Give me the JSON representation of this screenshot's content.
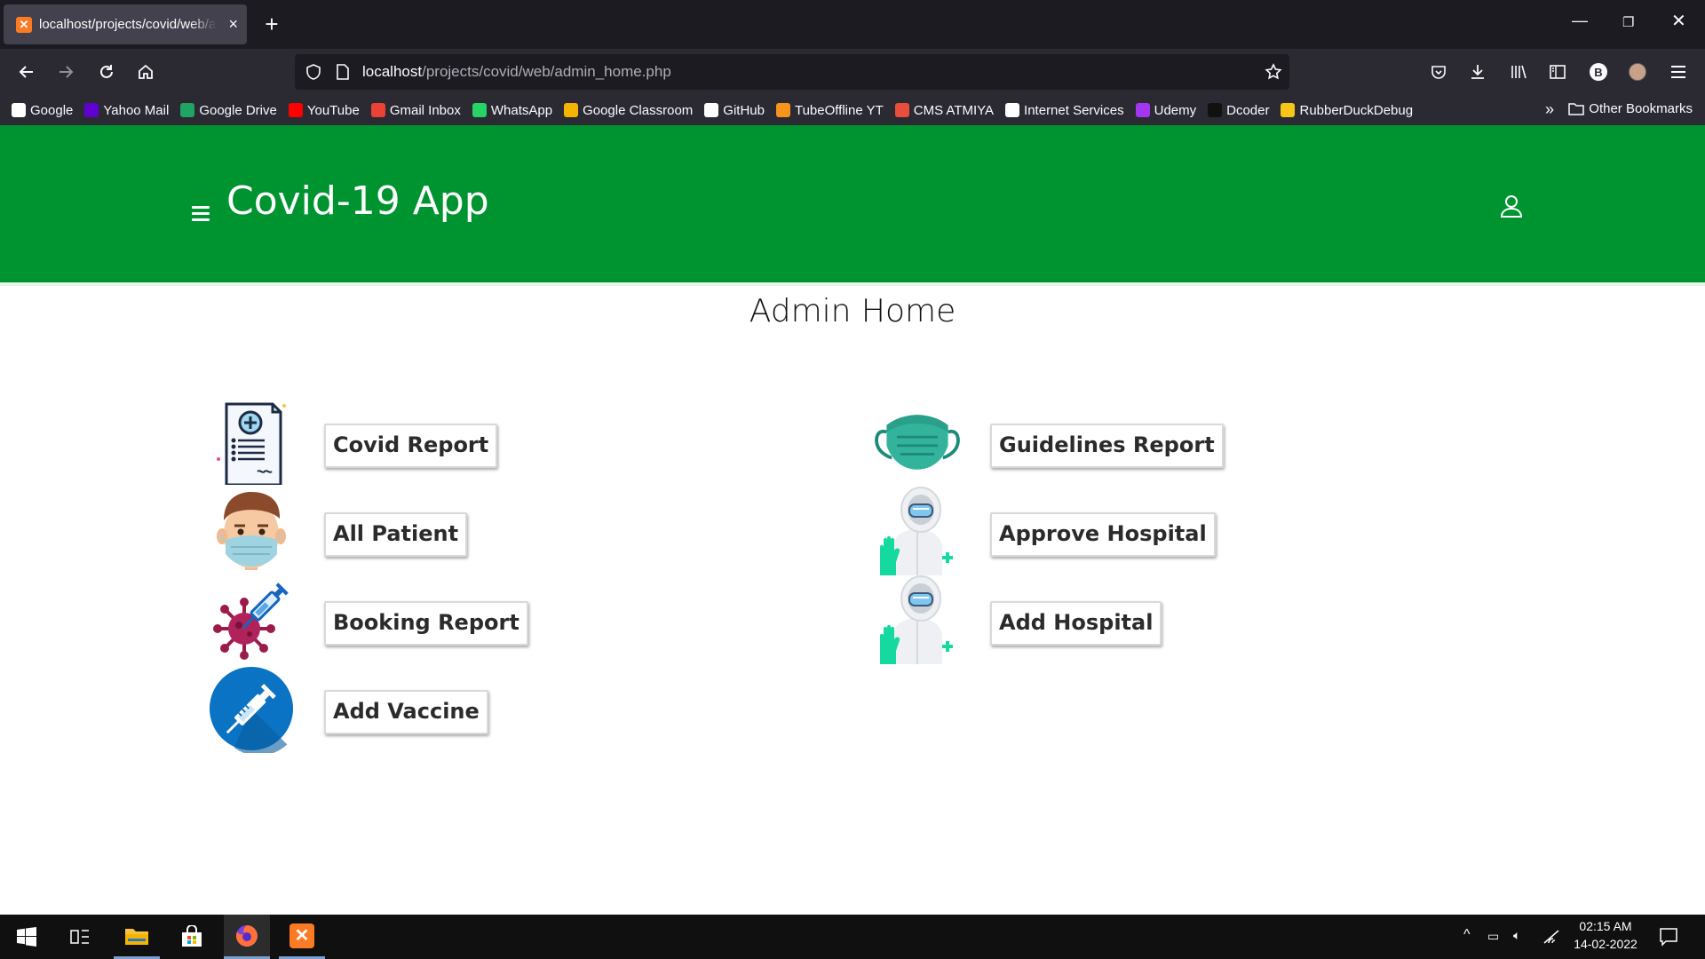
{
  "browser": {
    "tab_title": "localhost/projects/covid/web/admin_home.php",
    "url_host": "localhost",
    "url_path": "/projects/covid/web/admin_home.php",
    "bookmarks": [
      {
        "label": "Google",
        "icon": "google-icon",
        "color": "#ffffff"
      },
      {
        "label": "Yahoo Mail",
        "icon": "yahoo-mail-icon",
        "color": "#6001d2"
      },
      {
        "label": "Google Drive",
        "icon": "google-drive-icon",
        "color": "#1fa463"
      },
      {
        "label": "YouTube",
        "icon": "youtube-icon",
        "color": "#ff0000"
      },
      {
        "label": "Gmail Inbox",
        "icon": "gmail-icon",
        "color": "#ea4335"
      },
      {
        "label": "WhatsApp",
        "icon": "whatsapp-icon",
        "color": "#25d366"
      },
      {
        "label": "Google Classroom",
        "icon": "google-classroom-icon",
        "color": "#f4b400"
      },
      {
        "label": "GitHub",
        "icon": "github-icon",
        "color": "#ffffff"
      },
      {
        "label": "TubeOffline YT",
        "icon": "tubeoffline-icon",
        "color": "#f7941d"
      },
      {
        "label": "CMS ATMIYA",
        "icon": "cms-atmiya-icon",
        "color": "#e94e3c"
      },
      {
        "label": "Internet Services",
        "icon": "globe-icon",
        "color": "#ffffff"
      },
      {
        "label": "Udemy",
        "icon": "udemy-icon",
        "color": "#a435f0"
      },
      {
        "label": "Dcoder",
        "icon": "dcoder-icon",
        "color": "#111111"
      },
      {
        "label": "RubberDuckDebug",
        "icon": "rubber-duck-icon",
        "color": "#f5c518"
      }
    ],
    "other_bookmarks": "Other Bookmarks",
    "profile_letter": "B"
  },
  "app": {
    "title": "Covid-19 App",
    "header_color": "#009431",
    "page_title": "Admin Home",
    "menu_left": [
      {
        "label": "Covid Report",
        "icon": "medical-report-icon"
      },
      {
        "label": "All Patient",
        "icon": "masked-patient-icon"
      },
      {
        "label": "Booking Report",
        "icon": "virus-syringe-icon"
      },
      {
        "label": "Add Vaccine",
        "icon": "vaccine-syringe-icon"
      }
    ],
    "menu_right": [
      {
        "label": "Guidelines Report",
        "icon": "face-mask-icon"
      },
      {
        "label": "Approve Hospital",
        "icon": "hazmat-doctor-icon"
      },
      {
        "label": "Add Hospital",
        "icon": "hazmat-doctor-icon"
      }
    ]
  },
  "taskbar": {
    "time": "02:15 AM",
    "date": "14-02-2022"
  }
}
